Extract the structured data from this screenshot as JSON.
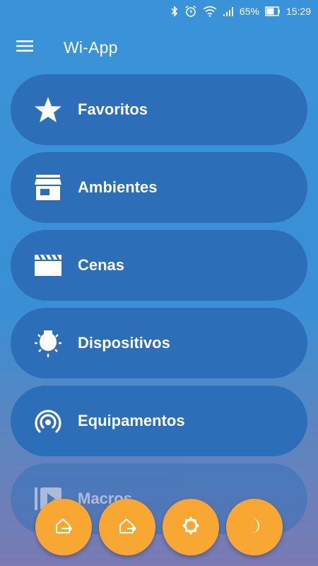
{
  "status": {
    "battery_pct": "65%",
    "time": "15:29",
    "icons": [
      "bluetooth-icon",
      "alarm-icon",
      "wifi-icon",
      "signal-icon",
      "battery-icon"
    ]
  },
  "app_bar": {
    "title": "Wi-App",
    "menu_icon": "hamburger-icon"
  },
  "menu": {
    "items": [
      {
        "label": "Favoritos",
        "icon": "star-icon"
      },
      {
        "label": "Ambientes",
        "icon": "storefront-icon"
      },
      {
        "label": "Cenas",
        "icon": "clapperboard-icon"
      },
      {
        "label": "Dispositivos",
        "icon": "bulb-icon"
      },
      {
        "label": "Equipamentos",
        "icon": "broadcast-icon"
      },
      {
        "label": "Macros",
        "icon": "play-box-icon"
      }
    ]
  },
  "fabs": [
    {
      "icon": "arrive-home-icon"
    },
    {
      "icon": "leave-home-icon"
    },
    {
      "icon": "sun-icon"
    },
    {
      "icon": "moon-icon"
    }
  ],
  "colors": {
    "background_top": "#3a93d8",
    "background_bottom": "#7a7ab4",
    "menu_item": "#2c6fb8",
    "fab": "#f8a832",
    "text": "#ffffff"
  }
}
